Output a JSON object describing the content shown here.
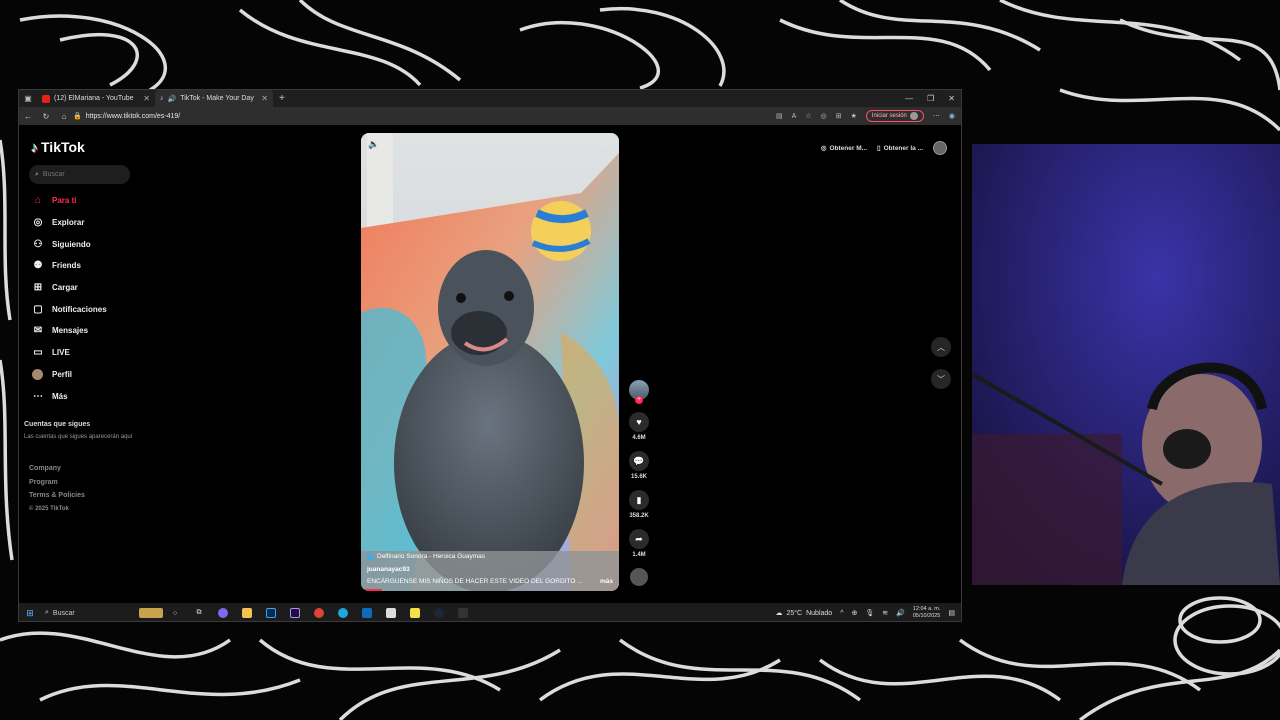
{
  "browser": {
    "tabs": [
      {
        "label": "(12) ElMariana - YouTube",
        "color": "#e62117"
      },
      {
        "label": "TikTok - Make Your Day",
        "color": "#111111"
      }
    ],
    "url": "https://www.tiktok.com/es-419/",
    "signin_label": "Iniciar sesión"
  },
  "sidebar": {
    "logo": "TikTok",
    "search_placeholder": "Buscar",
    "items": [
      {
        "label": "Para ti",
        "icon": "home-icon"
      },
      {
        "label": "Explorar",
        "icon": "compass-icon"
      },
      {
        "label": "Siguiendo",
        "icon": "following-icon"
      },
      {
        "label": "Friends",
        "icon": "friends-icon"
      },
      {
        "label": "Cargar",
        "icon": "upload-icon"
      },
      {
        "label": "Notificaciones",
        "icon": "inbox-icon"
      },
      {
        "label": "Mensajes",
        "icon": "message-icon"
      },
      {
        "label": "LIVE",
        "icon": "live-icon"
      },
      {
        "label": "Perfil",
        "icon": "avatar-icon"
      },
      {
        "label": "Más",
        "icon": "more-icon"
      }
    ],
    "following_title": "Cuentas que sigues",
    "following_desc": "Las cuentas que sigues aparecerán aquí",
    "footer": [
      "Company",
      "Program",
      "Terms & Policies"
    ],
    "copyright": "© 2025 TikTok"
  },
  "video": {
    "music": "Delfinario Sonora - Heroica Guaymas",
    "author": "juananayac93",
    "description": "ENCÁRGUENSE MIS NIÑOS DE HACER ESTE VIDEO DEL GORDITO ...",
    "more": "más",
    "progress": 0.08
  },
  "actions": {
    "likes": "4.6M",
    "comments": "15.6K",
    "saves": "358.2K",
    "shares": "1.4M"
  },
  "top_right": {
    "get_app_1": "Obtener M...",
    "get_app_2": "Obtener la ..."
  },
  "taskbar": {
    "search": "Buscar",
    "weather": "25°C",
    "weather_label": "Nublado",
    "time": "12:04 a. m.",
    "date": "05/10/2025"
  },
  "colors": {
    "accent": "#fe2c55",
    "cyan": "#25f4ee"
  }
}
